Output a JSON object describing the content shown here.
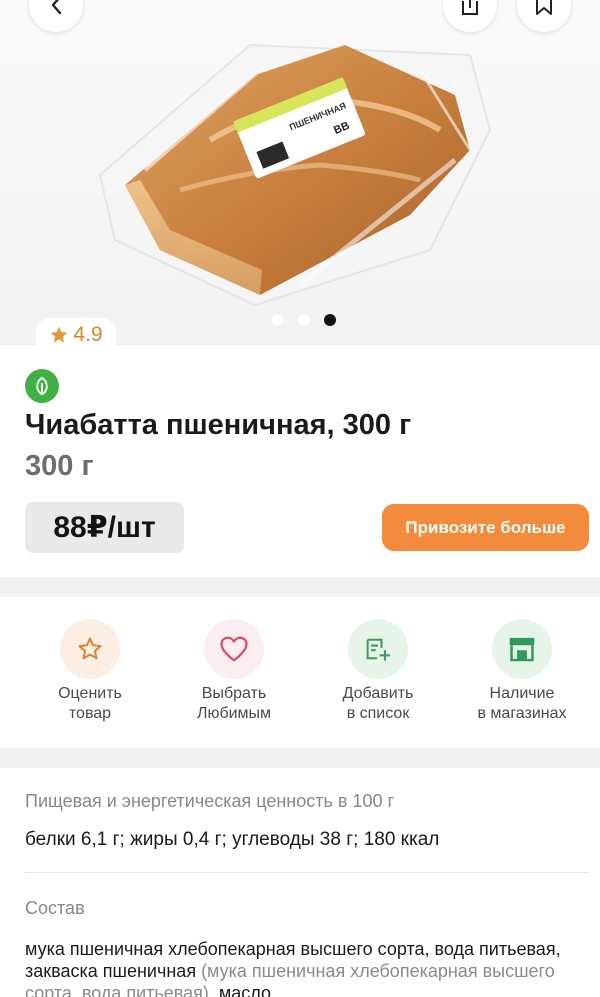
{
  "rating": "4.9",
  "gallery": {
    "total": 3,
    "active_index": 2
  },
  "package_label": {
    "product_name": "ПШЕНИЧНАЯ",
    "brand_mark": "ВВ"
  },
  "product": {
    "title": "Чиабатта пшеничная, 300 г",
    "weight": "300 г",
    "price": "88₽/шт",
    "cta_label": "Привозите больше"
  },
  "actions": [
    {
      "line1": "Оценить",
      "line2": "товар",
      "icon": "star-icon"
    },
    {
      "line1": "Выбрать",
      "line2": "Любимым",
      "icon": "heart-icon"
    },
    {
      "line1": "Добавить",
      "line2": "в список",
      "icon": "list-add-icon"
    },
    {
      "line1": "Наличие",
      "line2": "в магазинах",
      "icon": "store-icon"
    }
  ],
  "nutrition": {
    "heading": "Пищевая и энергетическая ценность в 100 г",
    "text": "белки 6,1 г; жиры 0,4 г; углеводы 38 г; 180 ккал"
  },
  "composition": {
    "heading": "Состав",
    "text_main": "мука пшеничная хлебопекарная высшего сорта, вода питьевая, закваска пшеничная",
    "text_muted": " (мука пшеничная хлебопекарная высшего сорта, вода питьевая)",
    "text_tail": ", масло"
  },
  "colors": {
    "accent": "#f28c3c",
    "rating": "#c98a2b",
    "leaf": "#43b045",
    "store": "#2e9b5a"
  }
}
